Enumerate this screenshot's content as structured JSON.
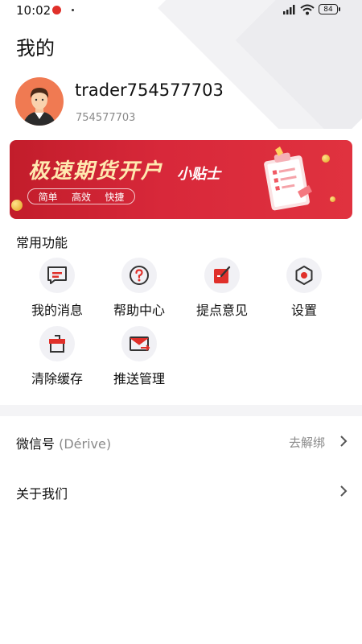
{
  "status_bar": {
    "time": "10:02",
    "battery": "84"
  },
  "page_title": "我的",
  "profile": {
    "username": "trader754577703",
    "user_id": "754577703"
  },
  "banner": {
    "title": "极速期货开户",
    "subtitle": "小贴士",
    "tags": [
      "简单",
      "高效",
      "快捷"
    ]
  },
  "functions": {
    "section_title": "常用功能",
    "items": [
      {
        "label": "我的消息",
        "icon": "message-icon"
      },
      {
        "label": "帮助中心",
        "icon": "help-icon"
      },
      {
        "label": "提点意见",
        "icon": "feedback-edit-icon"
      },
      {
        "label": "设置",
        "icon": "settings-icon"
      },
      {
        "label": "清除缓存",
        "icon": "clear-cache-icon"
      },
      {
        "label": "推送管理",
        "icon": "push-mail-icon"
      }
    ]
  },
  "settings_rows": [
    {
      "label": "微信号",
      "label_sub": "(Dérive)",
      "value": "去解绑"
    },
    {
      "label": "关于我们",
      "label_sub": "",
      "value": ""
    }
  ],
  "colors": {
    "accent": "#e0302a",
    "banner_gold": "#ffe9b0"
  }
}
